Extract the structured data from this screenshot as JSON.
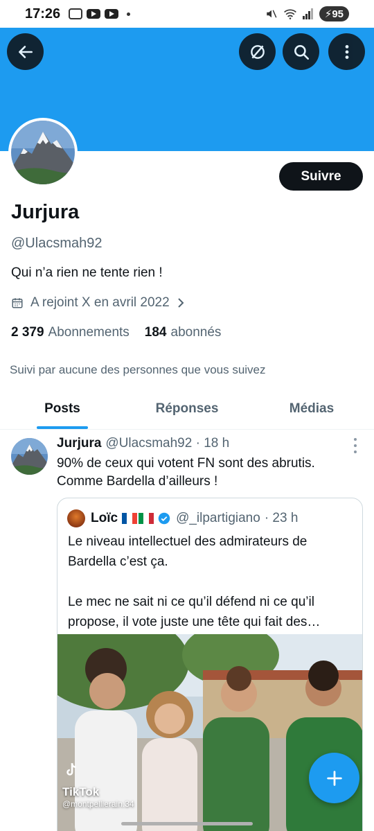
{
  "status_bar": {
    "time": "17:26",
    "battery": "95",
    "network": "6"
  },
  "profile": {
    "name": "Jurjura",
    "handle": "@Ulacsmah92",
    "bio": "Qui n’a rien ne tente rien !",
    "joined": "A rejoint X en avril 2022",
    "following_count": "2 379",
    "following_label": "Abonnements",
    "followers_count": "184",
    "followers_label": "abonnés",
    "followed_by": "Suivi par aucune des personnes que vous suivez",
    "follow_button": "Suivre"
  },
  "tabs": [
    {
      "label": "Posts",
      "active": true
    },
    {
      "label": "Réponses",
      "active": false
    },
    {
      "label": "Médias",
      "active": false
    }
  ],
  "tweet": {
    "name": "Jurjura",
    "handle": "@Ulacsmah92",
    "time": "· 18 h",
    "text": "90% de ceux qui votent FN sont des abrutis. Comme Bardella d’ailleurs !",
    "quote": {
      "name": "Loïc",
      "handle": "@_ilpartigiano",
      "time": "· 23 h",
      "text": "Le niveau intellectuel des admirateurs de Bardella c’est ça.\n\nLe mec ne sait ni ce qu’il défend ni ce qu’il propose, il vote juste une tête qui fait des…",
      "media_watermark_brand": "TikTok",
      "media_watermark_user": "@montpellierain.34"
    }
  },
  "colors": {
    "accent": "#1d9bf0",
    "text": "#0f1419",
    "muted": "#536471"
  },
  "icons": {
    "back": "arrow-left-icon",
    "grok": "grok-icon",
    "search": "search-icon",
    "more": "more-vertical-icon",
    "calendar": "calendar-icon",
    "chevron": "chevron-right-icon",
    "verified": "verified-badge-icon",
    "compose": "plus-icon"
  }
}
